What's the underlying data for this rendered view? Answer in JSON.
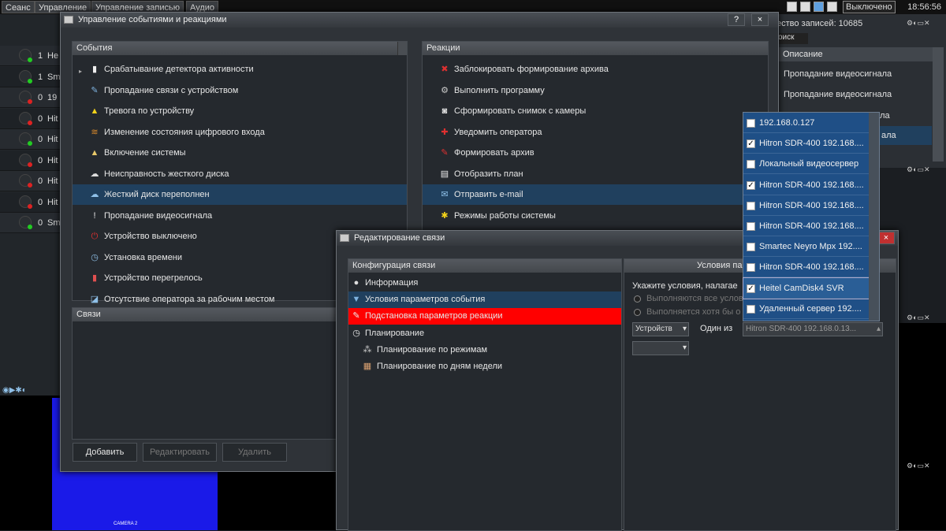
{
  "topbar": {
    "menus": [
      "Сеанс",
      "Управление",
      "Управление записью",
      "Аудио"
    ],
    "status": "Выключено",
    "time": "18:56:56"
  },
  "background": {
    "records": "ество записей: 10685",
    "search_tab": "оиск",
    "desc_header": "Описание",
    "desc_items": [
      "Пропадание видеосигнала",
      "Пропадание видеосигнала",
      "ала",
      "ала"
    ],
    "left_rows": [
      {
        "num": "1",
        "label": "He",
        "color": "#22cc22"
      },
      {
        "num": "1",
        "label": "Sm",
        "color": "#22cc22"
      },
      {
        "num": "0",
        "label": "19",
        "color": "#dd2222"
      },
      {
        "num": "0",
        "label": "Hit",
        "color": "#dd2222"
      },
      {
        "num": "0",
        "label": "Hit",
        "color": "#22cc22"
      },
      {
        "num": "0",
        "label": "Hit",
        "color": "#dd2222"
      },
      {
        "num": "0",
        "label": "Hit",
        "color": "#dd2222"
      },
      {
        "num": "0",
        "label": "Hit",
        "color": "#dd2222"
      },
      {
        "num": "0",
        "label": "Sm",
        "color": "#22cc22"
      }
    ],
    "camera_label": "CAMERA 2"
  },
  "main_window": {
    "title": "Управление событиями и реакциями",
    "help": "?",
    "close": "×",
    "events_header": "События",
    "events": [
      {
        "label": "Срабатывание детектора активности",
        "icon": "detector-icon",
        "glyph": "▮",
        "color": "#eee"
      },
      {
        "label": "Пропадание связи с устройством",
        "icon": "link-lost-icon",
        "glyph": "✎",
        "color": "#7fb3e0"
      },
      {
        "label": "Тревога по устройству",
        "icon": "warning-icon",
        "glyph": "▲",
        "color": "#f2d21a"
      },
      {
        "label": "Изменение состояния цифрового входа",
        "icon": "digital-input-icon",
        "glyph": "≋",
        "color": "#d98a2b"
      },
      {
        "label": "Включение системы",
        "icon": "power-on-icon",
        "glyph": "▲",
        "color": "#e8c96a"
      },
      {
        "label": "Неисправность жесткого диска",
        "icon": "hdd-fault-icon",
        "glyph": "☁",
        "color": "#ddd"
      },
      {
        "label": "Жесткий диск переполнен",
        "icon": "hdd-full-icon",
        "glyph": "☁",
        "color": "#8fc0e8"
      },
      {
        "label": "Пропадание видеосигнала",
        "icon": "video-lost-icon",
        "glyph": "!",
        "color": "#eee"
      },
      {
        "label": "Устройство выключено",
        "icon": "device-off-icon",
        "glyph": "⏻",
        "color": "#e03030"
      },
      {
        "label": "Установка времени",
        "icon": "clock-icon",
        "glyph": "◷",
        "color": "#8fc0e8"
      },
      {
        "label": "Устройство перегрелось",
        "icon": "thermometer-icon",
        "glyph": "▮",
        "color": "#e05050"
      },
      {
        "label": "Отсутствие оператора за рабочим местом",
        "icon": "operator-absent-icon",
        "glyph": "◪",
        "color": "#8fc0e8"
      }
    ],
    "reactions_header": "Реакции",
    "reactions": [
      {
        "label": "Заблокировать формирование архива",
        "icon": "block-icon",
        "glyph": "✖",
        "color": "#e03030"
      },
      {
        "label": "Выполнить программу",
        "icon": "gears-icon",
        "glyph": "⚙",
        "color": "#ccc"
      },
      {
        "label": "Сформировать снимок с камеры",
        "icon": "camera-icon",
        "glyph": "◙",
        "color": "#ddd"
      },
      {
        "label": "Уведомить оператора",
        "icon": "pin-icon",
        "glyph": "✚",
        "color": "#e03030"
      },
      {
        "label": "Формировать архив",
        "icon": "pencil-icon",
        "glyph": "✎",
        "color": "#e03030"
      },
      {
        "label": "Отобразить план",
        "icon": "document-icon",
        "glyph": "▤",
        "color": "#eee"
      },
      {
        "label": "Отправить e-mail",
        "icon": "email-icon",
        "glyph": "✉",
        "color": "#8fc0e8"
      },
      {
        "label": "Режимы работы системы",
        "icon": "modes-icon",
        "glyph": "✱",
        "color": "#f2d21a"
      }
    ],
    "links_header": "Связи",
    "buttons": {
      "add": "Добавить",
      "edit": "Редактировать",
      "delete": "Удалить"
    }
  },
  "edit_dialog": {
    "title": "Редактирование связи",
    "config_header": "Конфигурация связи",
    "conditions_header": "Условия па",
    "config_items": [
      {
        "label": "Информация",
        "icon": "info-icon",
        "glyph": "●",
        "color": "#ddd",
        "sub": false,
        "state": ""
      },
      {
        "label": "Условия параметров события",
        "icon": "triangle-down-icon",
        "glyph": "▼",
        "color": "#7fb3e0",
        "sub": false,
        "state": "sel"
      },
      {
        "label": "Подстановка параметров реакции",
        "icon": "edit-icon",
        "glyph": "✎",
        "color": "#eee",
        "sub": false,
        "state": "red"
      },
      {
        "label": "Планирование",
        "icon": "clock-icon",
        "glyph": "◷",
        "color": "#eee",
        "sub": false,
        "state": ""
      },
      {
        "label": "Планирование по режимам",
        "icon": "modes-icon",
        "glyph": "⁂",
        "color": "#ccc",
        "sub": true,
        "state": ""
      },
      {
        "label": "Планирование по дням недели",
        "icon": "calendar-icon",
        "glyph": "▦",
        "color": "#d9a070",
        "sub": true,
        "state": ""
      }
    ],
    "hint": "Укажите условия, налагае",
    "radio1": "Выполняются все услов",
    "radio2": "Выполняется хотя бы о",
    "device_combo": "Устройств",
    "one_of": "Один из",
    "selected_value": "Hitron SDR-400 192.168.0.13..."
  },
  "dropdown": {
    "items": [
      {
        "label": "192.168.0.127",
        "checked": ""
      },
      {
        "label": "Hitron SDR-400 192.168....",
        "checked": "✓"
      },
      {
        "label": "Локальный видеосервер",
        "checked": ""
      },
      {
        "label": "Hitron SDR-400 192.168....",
        "checked": "✓"
      },
      {
        "label": "Hitron SDR-400 192.168....",
        "checked": ""
      },
      {
        "label": "Hitron SDR-400 192.168....",
        "checked": ""
      },
      {
        "label": "Smartec Neyro Mpx 192....",
        "checked": ""
      },
      {
        "label": "Hitron SDR-400 192.168....",
        "checked": ""
      },
      {
        "label": "Heitel CamDisk4 SVR",
        "checked": "✓"
      },
      {
        "label": "Удаленный сервер 192....",
        "checked": ""
      }
    ]
  }
}
